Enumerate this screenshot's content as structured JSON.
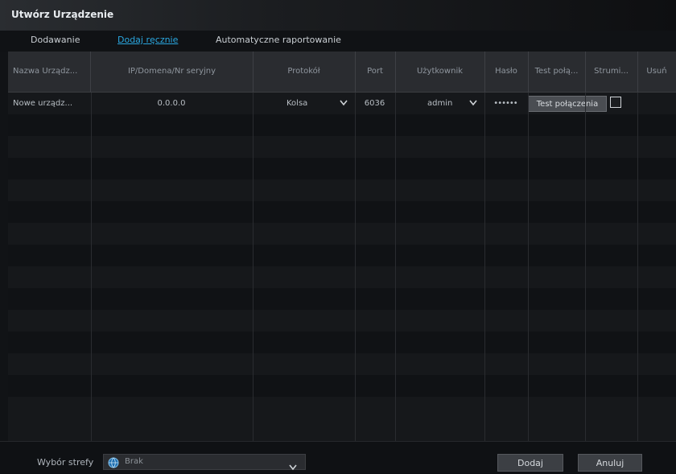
{
  "window": {
    "title": "Utwórz Urządzenie"
  },
  "tabs": [
    {
      "label": "Dodawanie",
      "active": false
    },
    {
      "label": "Dodaj ręcznie",
      "active": true
    },
    {
      "label": "Automatyczne raportowanie",
      "active": false
    }
  ],
  "table": {
    "columns": [
      "Nazwa Urządz...",
      "IP/Domena/Nr seryjny",
      "Protokół",
      "Port",
      "Użytkownik",
      "Hasło",
      "Test połą...",
      "Strumi...",
      "Usuń"
    ],
    "rows": [
      {
        "name": "Nowe urządz...",
        "ip": "0.0.0.0",
        "protocol": "Kolsa",
        "port": "6036",
        "user": "admin",
        "password": "••••••",
        "test_label": "Test połączenia",
        "stream_checked": false
      }
    ],
    "empty_rows": 14
  },
  "footer": {
    "zone_label": "Wybór strefy",
    "zone_value": "Brak",
    "add_button": "Dodaj",
    "close_button": "Anuluj"
  },
  "colors": {
    "accent": "#2aa7e0",
    "row_even": "#16181b",
    "row_odd": "#101215",
    "header": "#2a2c30"
  },
  "icons": {
    "protocol_dropdown": "chevron-down-icon",
    "user_dropdown": "chevron-down-icon",
    "zone_globe": "globe-icon",
    "zone_dropdown": "chevron-down-icon"
  }
}
